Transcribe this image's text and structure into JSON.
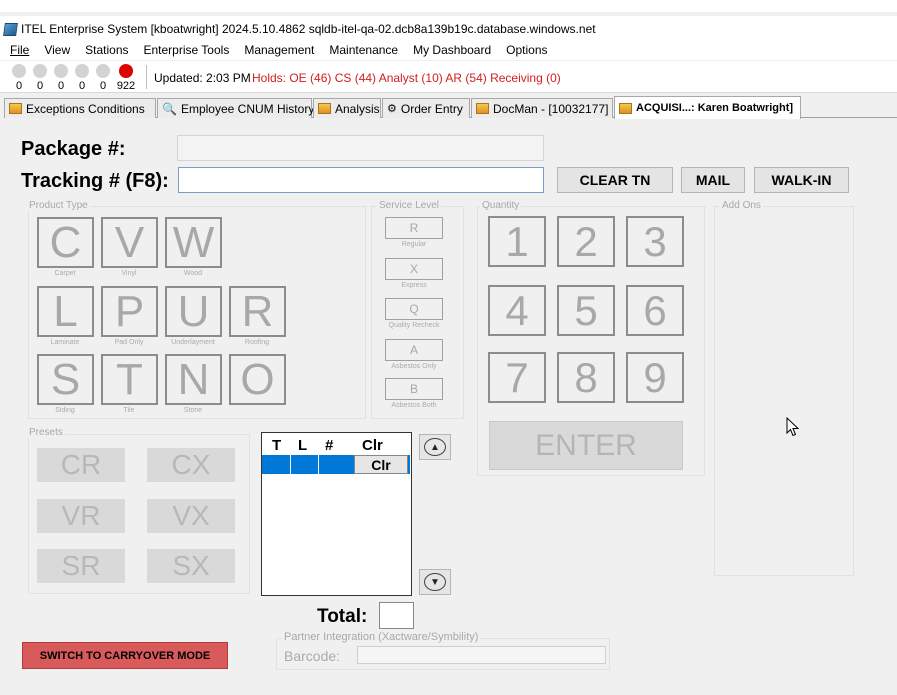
{
  "window": {
    "title": "ITEL Enterprise System [kboatwright] 2024.5.10.4862   sqldb-itel-qa-02.dcb8a139b19c.database.windows.net"
  },
  "menu": [
    "File",
    "View",
    "Stations",
    "Enterprise Tools",
    "Management",
    "Maintenance",
    "My Dashboard",
    "Options"
  ],
  "status": {
    "lights": [
      {
        "count": "0",
        "color": "#d3d3d3"
      },
      {
        "count": "0",
        "color": "#d3d3d3"
      },
      {
        "count": "0",
        "color": "#d3d3d3"
      },
      {
        "count": "0",
        "color": "#d3d3d3"
      },
      {
        "count": "0",
        "color": "#d3d3d3"
      },
      {
        "count": "922",
        "color": "#e00000"
      }
    ],
    "updated": "Updated: 2:03 PM",
    "holds": "Holds: OE (46) CS (44) Analyst (10) AR (54) Receiving (0)"
  },
  "tabs": [
    "Exceptions Conditions",
    "Employee CNUM History",
    "Analysis",
    "Order Entry",
    "DocMan - [10032177]",
    "ACQUISI...: Karen Boatwright]"
  ],
  "form": {
    "package_label": "Package #:",
    "package_value": "",
    "tracking_label": "Tracking # (F8):",
    "tracking_value": "",
    "clear_tn": "CLEAR TN",
    "mail": "MAIL",
    "walk_in": "WALK-IN"
  },
  "product_type": {
    "title": "Product Type",
    "keys": [
      {
        "letter": "C",
        "caption": "Carpet"
      },
      {
        "letter": "V",
        "caption": "Vinyl"
      },
      {
        "letter": "W",
        "caption": "Wood"
      },
      {
        "letter": "L",
        "caption": "Laminate"
      },
      {
        "letter": "P",
        "caption": "Pad Only"
      },
      {
        "letter": "U",
        "caption": "Underlayment"
      },
      {
        "letter": "R",
        "caption": "Roofing"
      },
      {
        "letter": "S",
        "caption": "Siding"
      },
      {
        "letter": "T",
        "caption": "Tile"
      },
      {
        "letter": "N",
        "caption": "Stone"
      },
      {
        "letter": "O",
        "caption": ""
      }
    ]
  },
  "service_level": {
    "title": "Service Level",
    "keys": [
      {
        "letter": "R",
        "caption": "Regular"
      },
      {
        "letter": "X",
        "caption": "Express"
      },
      {
        "letter": "Q",
        "caption": "Quality Recheck"
      },
      {
        "letter": "A",
        "caption": "Asbestos Only"
      },
      {
        "letter": "B",
        "caption": "Asbestos Both"
      }
    ]
  },
  "quantity": {
    "title": "Quantity",
    "keys": [
      "1",
      "2",
      "3",
      "4",
      "5",
      "6",
      "7",
      "8",
      "9"
    ],
    "enter": "ENTER"
  },
  "add_ons": {
    "title": "Add Ons"
  },
  "presets": {
    "title": "Presets",
    "keys": [
      "CR",
      "CX",
      "VR",
      "VX",
      "SR",
      "SX"
    ]
  },
  "grid": {
    "headers": [
      "T",
      "L",
      "#",
      "Clr"
    ],
    "row_clear": "Clr"
  },
  "total": {
    "label": "Total:",
    "value": ""
  },
  "carryover_button": "SWITCH TO CARRYOVER MODE",
  "partner": {
    "title": "Partner Integration (Xactware/Symbility)",
    "barcode_label": "Barcode:",
    "barcode_value": ""
  }
}
